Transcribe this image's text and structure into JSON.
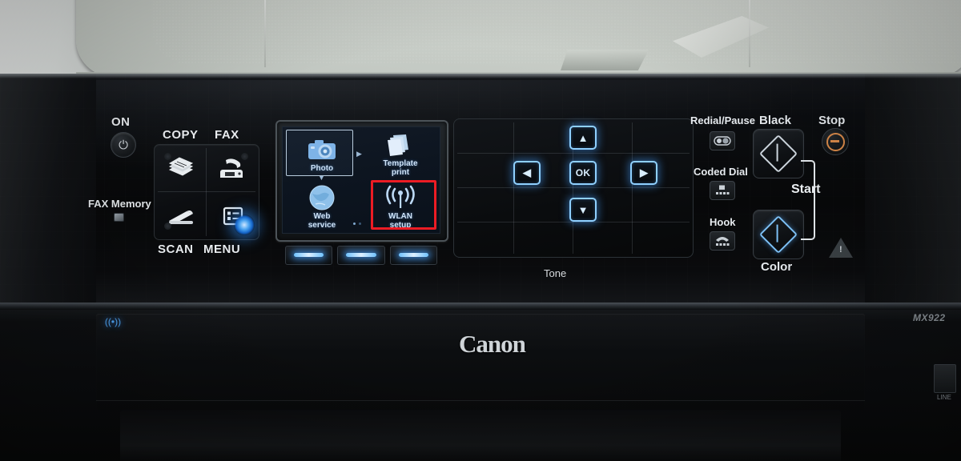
{
  "device": {
    "brand": "Canon",
    "model": "MX922",
    "line_port_label": "LINE"
  },
  "left_cluster": {
    "power_label": "ON",
    "power_icon": "power-icon",
    "copy_label": "COPY",
    "copy_icon": "copy-stack-icon",
    "fax_label": "FAX",
    "fax_icon": "fax-machine-icon",
    "scan_label": "SCAN",
    "scan_icon": "scanner-icon",
    "menu_label": "MENU",
    "menu_icon": "menu-list-icon",
    "fax_memory_label": "FAX Memory",
    "fax_memory_icon": "memory-led-icon"
  },
  "lcd": {
    "items": [
      {
        "caption": "Photo",
        "icon": "camera-icon",
        "selected": true,
        "highlighted": false
      },
      {
        "caption": "Template\nprint",
        "icon": "sheets-icon",
        "selected": false,
        "highlighted": false
      },
      {
        "caption": "Web\nservice",
        "icon": "globe-icon",
        "selected": false,
        "highlighted": false
      },
      {
        "caption": "WLAN\nsetup",
        "icon": "wifi-waves-icon",
        "selected": false,
        "highlighted": true
      }
    ],
    "item_captions": {
      "photo": "Photo",
      "template_line1": "Template",
      "template_line2": "print",
      "web_line1": "Web",
      "web_line2": "service",
      "wlan_line1": "WLAN",
      "wlan_line2": "setup"
    },
    "page_dots": 2,
    "active_page": 1,
    "highlight_color": "#ec1c24",
    "screen_text_color": "#cfe3f7"
  },
  "soft_keys": {
    "count": 3,
    "lit": true,
    "glow_color": "#6fc2ff"
  },
  "keypad": {
    "tone_label": "Tone",
    "nav": {
      "up": "▲",
      "down": "▼",
      "left": "◀",
      "right": "▶",
      "ok": "OK"
    },
    "nav_glow_color": "#8fd0ff"
  },
  "right_cluster": {
    "redial_label": "Redial/Pause",
    "redial_icon": "redial-pause-icon",
    "coded_dial_label": "Coded Dial",
    "coded_dial_icon": "coded-dial-icon",
    "hook_label": "Hook",
    "hook_icon": "hook-handset-icon",
    "black_label": "Black",
    "black_icon": "start-diamond-icon",
    "color_label": "Color",
    "color_icon": "start-diamond-color-icon",
    "start_label": "Start",
    "stop_label": "Stop",
    "stop_icon": "stop-circle-icon",
    "alert_icon": "alert-triangle-icon",
    "stop_accent_color": "#d98a4a",
    "color_accent": "#7dc0f5"
  },
  "status": {
    "wifi_indicator_icon": "wifi-indicator-icon",
    "wifi_lit": true,
    "wifi_color": "#4fa6f5"
  }
}
